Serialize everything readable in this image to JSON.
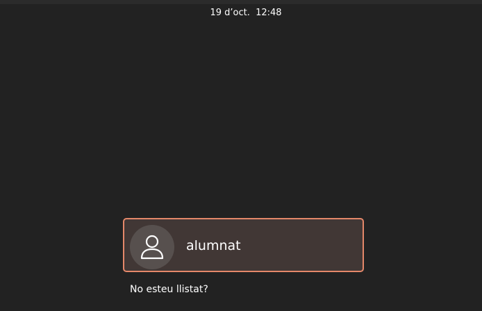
{
  "top_bar": {
    "datetime": "19 d’oct.  12:48"
  },
  "login": {
    "user": {
      "name": "alumnat",
      "avatar_icon": "user-icon"
    },
    "not_listed_label": "No esteu llistat?"
  },
  "colors": {
    "background": "#222222",
    "card_background": "#413735",
    "card_border": "#e5886a",
    "avatar_background": "#57504e"
  }
}
